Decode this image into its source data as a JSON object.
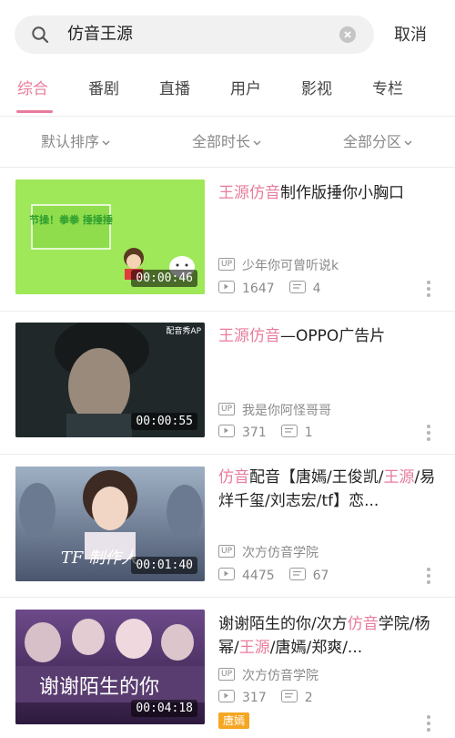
{
  "search": {
    "query": "仿音王源",
    "cancel_label": "取消"
  },
  "tabs": [
    {
      "label": "综合",
      "active": true
    },
    {
      "label": "番剧",
      "active": false
    },
    {
      "label": "直播",
      "active": false
    },
    {
      "label": "用户",
      "active": false
    },
    {
      "label": "影视",
      "active": false
    },
    {
      "label": "专栏",
      "active": false
    }
  ],
  "filters": [
    {
      "label": "默认排序"
    },
    {
      "label": "全部时长"
    },
    {
      "label": "全部分区"
    }
  ],
  "results": [
    {
      "title_parts": [
        {
          "text": "王源仿音",
          "hl": true
        },
        {
          "text": "制作版捶你小胸口",
          "hl": false
        }
      ],
      "duration": "00:00:46",
      "uploader": "少年你可曾听说k",
      "plays": "1647",
      "danmaku": "4",
      "thumb_text": "节操！拳拳 捶捶捶"
    },
    {
      "title_parts": [
        {
          "text": "王源仿音",
          "hl": true
        },
        {
          "text": "—OPPO广告片",
          "hl": false
        }
      ],
      "duration": "00:00:55",
      "uploader": "我是你阿怪哥哥",
      "plays": "371",
      "danmaku": "1",
      "thumb_text": "配音秀AP"
    },
    {
      "title_parts": [
        {
          "text": "仿音",
          "hl": true
        },
        {
          "text": "配音【唐嫣/王俊凯/",
          "hl": false
        },
        {
          "text": "王源",
          "hl": true
        },
        {
          "text": "/易烊千玺/刘志宏/tf】恋...",
          "hl": false
        }
      ],
      "duration": "00:01:40",
      "uploader": "次方仿音学院",
      "plays": "4475",
      "danmaku": "67",
      "thumb_text": "TF 制作人"
    },
    {
      "title_parts": [
        {
          "text": "谢谢陌生的你/次方",
          "hl": false
        },
        {
          "text": "仿音",
          "hl": true
        },
        {
          "text": "学院/杨幂/",
          "hl": false
        },
        {
          "text": "王源",
          "hl": true
        },
        {
          "text": "/唐嫣/郑爽/...",
          "hl": false
        }
      ],
      "duration": "00:04:18",
      "uploader": "次方仿音学院",
      "plays": "317",
      "danmaku": "2",
      "tag": "唐嫣",
      "thumb_text": "谢谢陌生的你"
    }
  ],
  "badges": {
    "up": "UP"
  },
  "icons": {
    "search": "search-icon",
    "clear": "clear-icon",
    "play": "play-count-icon",
    "danmaku": "danmaku-icon",
    "more": "more-vertical-icon",
    "caret": "chevron-down-icon"
  },
  "colors": {
    "accent": "#e87c9c",
    "tag": "#f5a623"
  }
}
